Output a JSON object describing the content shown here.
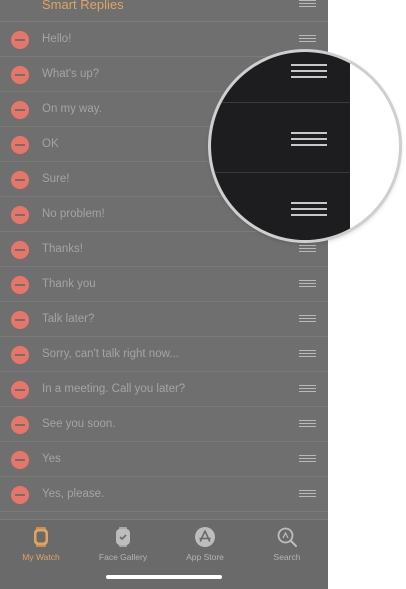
{
  "header": {
    "title": "Smart Replies"
  },
  "replies": [
    "Hello!",
    "What's up?",
    "On my way.",
    "OK",
    "Sure!",
    "No problem!",
    "Thanks!",
    "Thank you",
    "Talk later?",
    "Sorry, can't talk right now...",
    "In a meeting. Call you later?",
    "See you soon.",
    "Yes",
    "Yes, please."
  ],
  "tabs": [
    {
      "label": "My Watch",
      "icon": "watch-icon",
      "active": true
    },
    {
      "label": "Face Gallery",
      "icon": "face-gallery-icon",
      "active": false
    },
    {
      "label": "App Store",
      "icon": "app-store-icon",
      "active": false
    },
    {
      "label": "Search",
      "icon": "search-icon",
      "active": false
    }
  ],
  "colors": {
    "accent": "#e0a461",
    "delete": "#e8756a",
    "overlay": "#6f6f6f"
  }
}
